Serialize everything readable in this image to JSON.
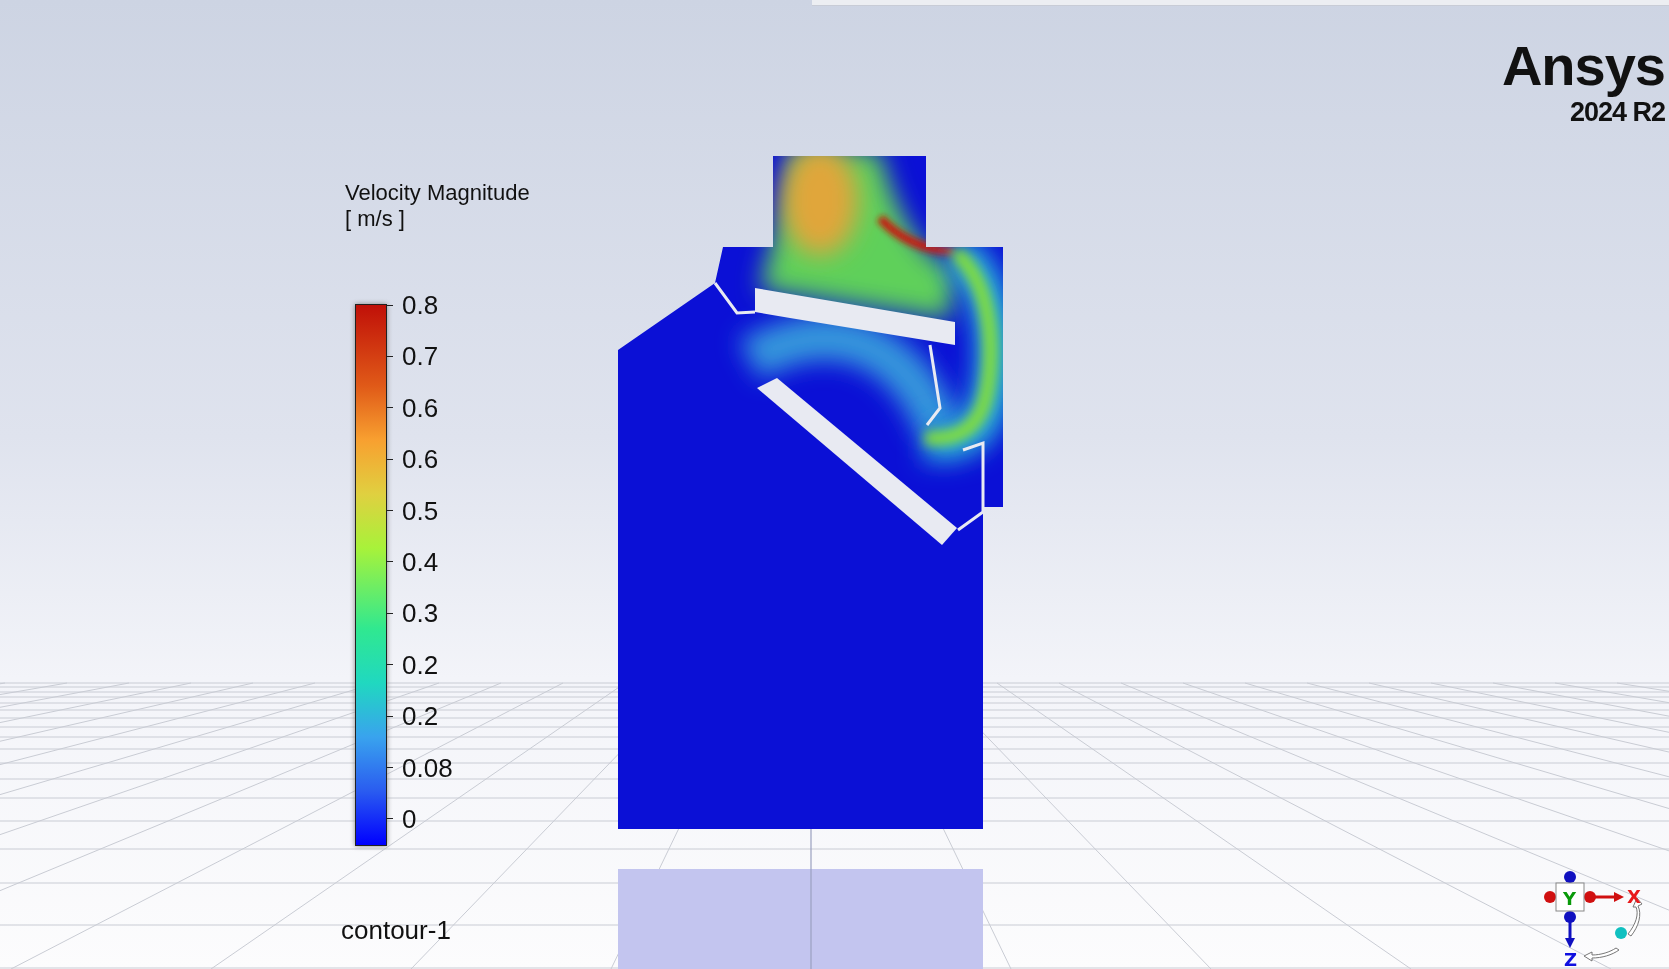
{
  "logo": {
    "name": "Ansys",
    "version": "2024 R2"
  },
  "legend": {
    "title": "Velocity Magnitude",
    "unit": "[ m/s ]",
    "ticks": [
      "0.8",
      "0.7",
      "0.6",
      "0.6",
      "0.5",
      "0.4",
      "0.3",
      "0.2",
      "0.2",
      "0.08",
      "0"
    ]
  },
  "contour_name": "contour-1",
  "triad": {
    "axes": [
      {
        "label": "X",
        "color": "#e8191b"
      },
      {
        "label": "Y",
        "color": "#0a9a0a"
      },
      {
        "label": "Z",
        "color": "#1010e0"
      }
    ]
  }
}
